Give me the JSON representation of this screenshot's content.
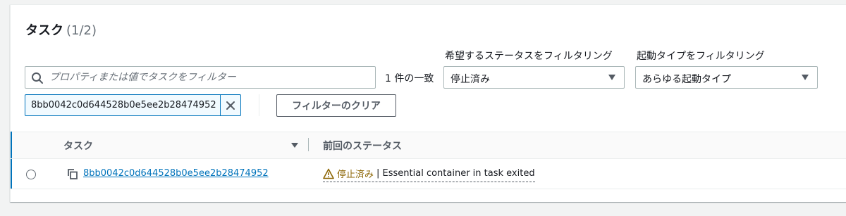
{
  "header": {
    "title": "タスク",
    "count": "(1/2)"
  },
  "filters": {
    "search_placeholder": "プロパティまたは値でタスクをフィルター",
    "match_count": "1 件の一致",
    "status_filter": {
      "label": "希望するステータスをフィルタリング",
      "selected": "停止済み"
    },
    "launch_type_filter": {
      "label": "起動タイプをフィルタリング",
      "selected": "あらゆる起動タイプ"
    },
    "token": "8bb0042c0d644528b0e5ee2b28474952",
    "clear_button": "フィルターのクリア"
  },
  "table": {
    "columns": [
      "タスク",
      "前回のステータス"
    ],
    "rows": [
      {
        "task_id": "8bb0042c0d644528b0e5ee2b28474952",
        "status": "停止済み",
        "status_detail": "| Essential container in task exited"
      }
    ]
  },
  "colors": {
    "link": "#0073bb",
    "warning": "#8d6605",
    "text": "#16191f",
    "muted": "#687078"
  },
  "icons": [
    "search-icon",
    "close-icon",
    "caret-down-icon",
    "sort-icon",
    "copy-icon",
    "warning-icon"
  ]
}
